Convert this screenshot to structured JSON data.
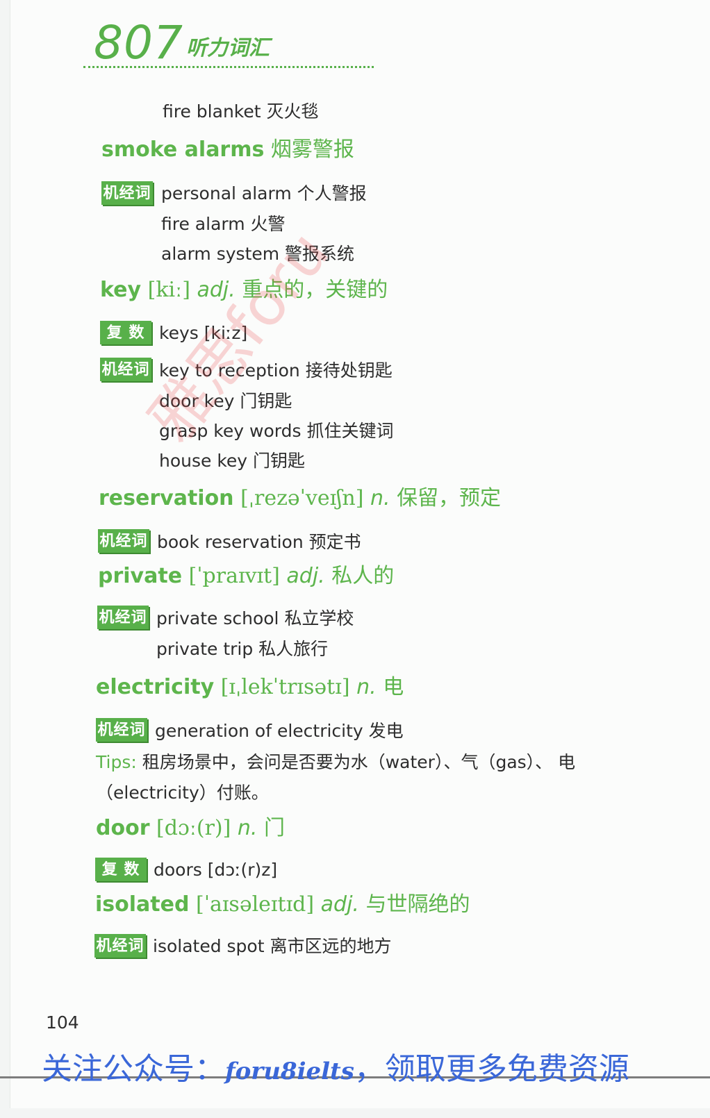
{
  "header": {
    "number": "807",
    "title": "听力词汇"
  },
  "tags": {
    "collocation": "机经词汇",
    "plural": "复 数"
  },
  "entries": {
    "fire_blanket": "fire blanket 灭火毯",
    "smoke_alarms": {
      "word": "smoke alarms",
      "meaning": "烟雾警报"
    },
    "smoke_items": [
      "personal alarm 个人警报",
      "fire alarm 火警",
      "alarm system 警报系统"
    ],
    "key": {
      "word": "key",
      "phonetic": "[kiː]",
      "pos": "adj.",
      "meaning": "重点的，关键的"
    },
    "key_plural": "keys [kiːz]",
    "key_items": [
      "key to reception 接待处钥匙",
      "door key 门钥匙",
      "grasp key words 抓住关键词",
      "house key 门钥匙"
    ],
    "reservation": {
      "word": "reservation",
      "phonetic": "[ˌrezəˈveɪʃn]",
      "pos": "n.",
      "meaning": "保留，预定"
    },
    "reservation_items": [
      "book reservation 预定书"
    ],
    "private": {
      "word": "private",
      "phonetic": "[ˈpraɪvɪt]",
      "pos": "adj.",
      "meaning": "私人的"
    },
    "private_items": [
      "private school 私立学校",
      "private trip 私人旅行"
    ],
    "electricity": {
      "word": "electricity",
      "phonetic": "[ɪˌlekˈtrɪsətɪ]",
      "pos": "n.",
      "meaning": "电"
    },
    "electricity_items": [
      "generation of electricity 发电"
    ],
    "tips": {
      "label": "Tips:",
      "line1": "租房场景中，会问是否要为水（water）、气（gas）、 电",
      "line2": "（electricity）付账。"
    },
    "door": {
      "word": "door",
      "phonetic": "[dɔː(r)]",
      "pos": "n.",
      "meaning": "门"
    },
    "door_plural": "doors [dɔː(r)z]",
    "isolated": {
      "word": "isolated",
      "phonetic": "[ˈaɪsəleɪtɪd]",
      "pos": "adj.",
      "meaning": "与世隔绝的"
    },
    "isolated_items": [
      "isolated spot 离市区远的地方"
    ]
  },
  "page_number": "104",
  "watermark": "雅思foru",
  "footer": {
    "prefix": "关注公众号：",
    "account": "foru8ielts",
    "suffix": "，领取更多免费资源"
  },
  "colors": {
    "accent_green": "#58b04a",
    "footer_blue": "#3a67d8",
    "watermark_red": "#e64646"
  }
}
